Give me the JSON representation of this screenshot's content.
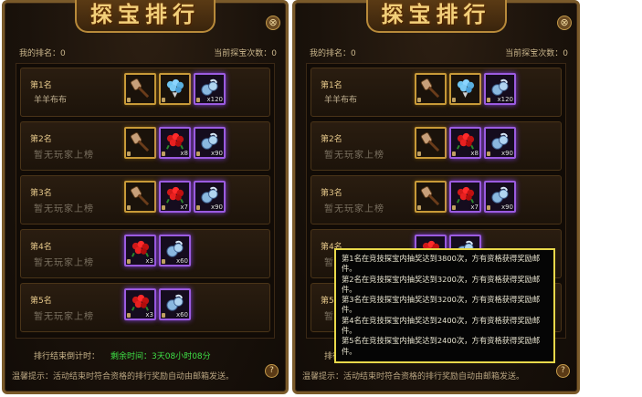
{
  "title": "探宝排行",
  "close_symbol": "⊗",
  "help_symbol": "?",
  "my_rank_label": "我的排名：0",
  "current_count_label": "当前探宝次数：0",
  "ranks": [
    {
      "rank": "第1名",
      "player": "羊羊布布",
      "dim": false,
      "items": [
        {
          "icon": "shovel-icon",
          "border": "gold",
          "qty": ""
        },
        {
          "icon": "blue-rose-bouquet-icon",
          "border": "gold",
          "qty": ""
        },
        {
          "icon": "pouch-icon",
          "border": "purple",
          "qty": "x120"
        }
      ]
    },
    {
      "rank": "第2名",
      "player": "暂无玩家上榜",
      "dim": true,
      "items": [
        {
          "icon": "shovel-icon",
          "border": "gold",
          "qty": ""
        },
        {
          "icon": "red-rose-bouquet-icon",
          "border": "purple",
          "qty": "x8"
        },
        {
          "icon": "pouch-icon",
          "border": "purple",
          "qty": "x90"
        }
      ]
    },
    {
      "rank": "第3名",
      "player": "暂无玩家上榜",
      "dim": true,
      "items": [
        {
          "icon": "shovel-icon",
          "border": "gold",
          "qty": ""
        },
        {
          "icon": "red-rose-bouquet-icon",
          "border": "purple",
          "qty": "x7"
        },
        {
          "icon": "pouch-icon",
          "border": "purple",
          "qty": "x90"
        }
      ]
    },
    {
      "rank": "第4名",
      "player": "暂无玩家上榜",
      "dim": true,
      "items": [
        {
          "icon": "red-rose-bouquet-icon",
          "border": "purple",
          "qty": "x3"
        },
        {
          "icon": "pouch-icon",
          "border": "purple",
          "qty": "x60"
        }
      ]
    },
    {
      "rank": "第5名",
      "player": "暂无玩家上榜",
      "dim": true,
      "items": [
        {
          "icon": "red-rose-bouquet-icon",
          "border": "purple",
          "qty": "x3"
        },
        {
          "icon": "pouch-icon",
          "border": "purple",
          "qty": "x60"
        }
      ]
    }
  ],
  "footer": {
    "end_label": "排行结束倒计时：",
    "remaining": "剩余时间：3天08小时08分",
    "tip": "温馨提示：活动结束时符合资格的排行奖励自动由邮箱发送。"
  },
  "tooltip_lines": [
    "第1名在竞技探宝内抽奖达到3800次，方有资格获得奖励邮件。",
    "第2名在竞技探宝内抽奖达到3200次，方有资格获得奖励邮件。",
    "第3名在竞技探宝内抽奖达到3200次，方有资格获得奖励邮件。",
    "第4名在竞技探宝内抽奖达到2400次，方有资格获得奖励邮件。",
    "第5名在竞技探宝内抽奖达到2400次，方有资格获得奖励邮件。"
  ],
  "colors": {
    "accent_gold": "#f2cf7a",
    "time_green": "#3ee046",
    "tooltip_border": "#e8d84a"
  }
}
